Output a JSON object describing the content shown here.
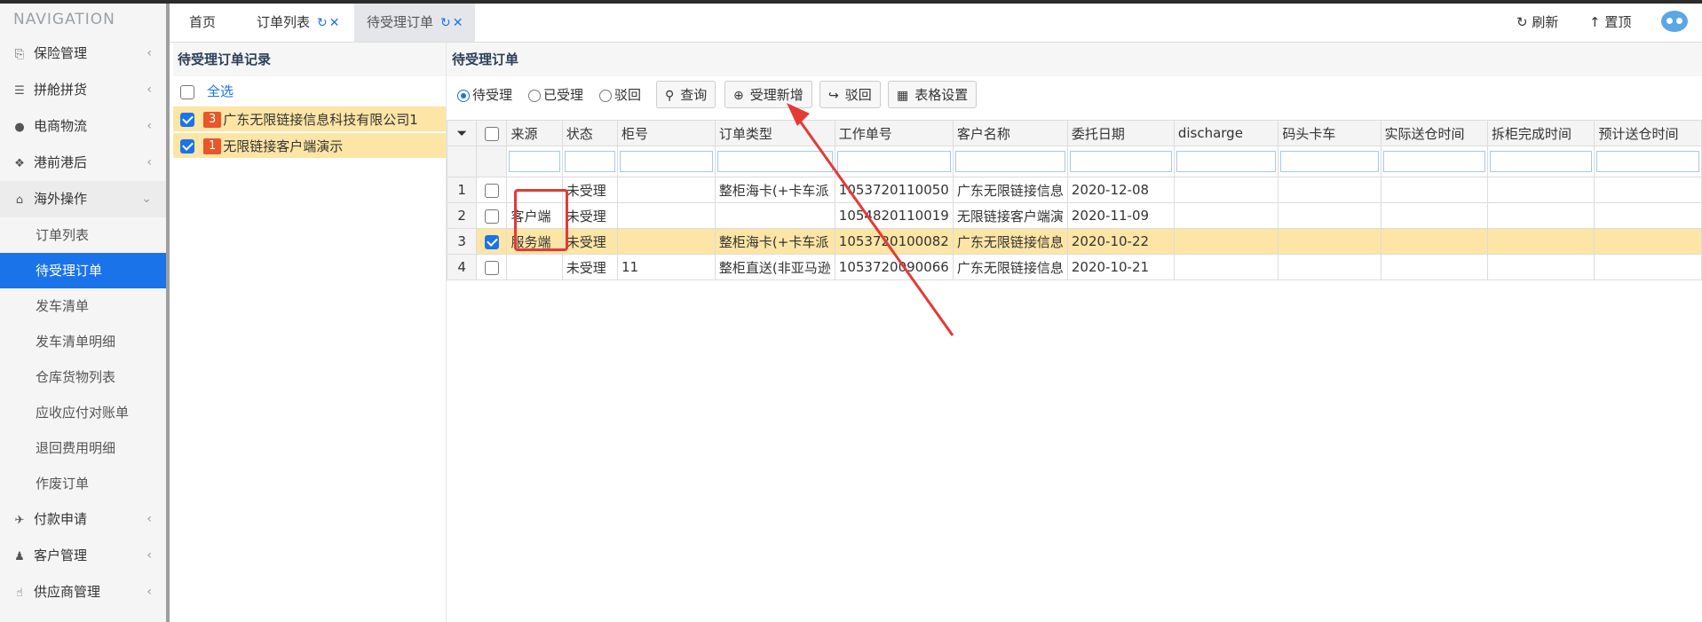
{
  "nav": {
    "title": "NAVIGATION",
    "menu": [
      {
        "label": "保险管理",
        "icon": "insurance-icon"
      },
      {
        "label": "拼舱拼货",
        "icon": "stack-icon"
      },
      {
        "label": "电商物流",
        "icon": "globe-icon"
      },
      {
        "label": "港前港后",
        "icon": "cubes-icon"
      },
      {
        "label": "海外操作",
        "icon": "bank-icon"
      }
    ],
    "sub": [
      "订单列表",
      "待受理订单",
      "发车清单",
      "发车清单明细",
      "仓库货物列表",
      "应收应付对账单",
      "退回费用明细",
      "作废订单"
    ],
    "menu2": [
      {
        "label": "付款申请",
        "icon": "payment-icon"
      },
      {
        "label": "客户管理",
        "icon": "users-icon"
      },
      {
        "label": "供应商管理",
        "icon": "thumbs-up-icon"
      }
    ]
  },
  "tabs": {
    "home": "首页",
    "order_list": "订单列表",
    "pending": "待受理订单",
    "refresh": "刷新",
    "top": "置顶"
  },
  "left_panel": {
    "title": "待受理订单记录",
    "select_all": "全选",
    "records": [
      {
        "count": "3",
        "name": "广东无限链接信息科技有限公司1"
      },
      {
        "count": "1",
        "name": "无限链接客户端演示"
      }
    ]
  },
  "main": {
    "title": "待受理订单",
    "radios": [
      "待受理",
      "已受理",
      "驳回"
    ],
    "buttons": {
      "query": "查询",
      "accept_new": "受理新增",
      "reject": "驳回",
      "table_settings": "表格设置"
    },
    "columns": [
      "来源",
      "状态",
      "柜号",
      "订单类型",
      "工作单号",
      "客户名称",
      "委托日期",
      "discharge",
      "码头卡车",
      "实际送仓时间",
      "拆柜完成时间",
      "预计送仓时间"
    ],
    "rows": [
      {
        "no": "1",
        "source": "",
        "status": "未受理",
        "container": "",
        "type": "整柜海卡(+卡车派",
        "work_no": "1053720110050",
        "customer": "广东无限链接信息",
        "date": "2020-12-08"
      },
      {
        "no": "2",
        "source": "客户端",
        "status": "未受理",
        "container": "",
        "type": "",
        "work_no": "1054820110019",
        "customer": "无限链接客户端演",
        "date": "2020-11-09"
      },
      {
        "no": "3",
        "source": "服务端",
        "status": "未受理",
        "container": "",
        "type": "整柜海卡(+卡车派",
        "work_no": "1053720100082",
        "customer": "广东无限链接信息",
        "date": "2020-10-22"
      },
      {
        "no": "4",
        "source": "",
        "status": "未受理",
        "container": "11",
        "type": "整柜直送(非亚马逊",
        "work_no": "1053720090066",
        "customer": "广东无限链接信息",
        "date": "2020-10-21"
      }
    ]
  },
  "colors": {
    "accent": "#1a73e8",
    "highlight_row": "#fde5a6",
    "badge": "#e8562a",
    "annotation": "#e53935"
  }
}
